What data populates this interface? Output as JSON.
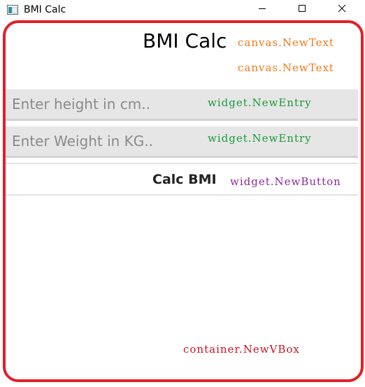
{
  "window": {
    "title": "BMI Calc"
  },
  "app": {
    "heading": "BMI Calc"
  },
  "annotations": {
    "canvas_text_1": "canvas.NewText",
    "canvas_text_2": "canvas.NewText",
    "entry_1": "widget.NewEntry",
    "entry_2": "widget.NewEntry",
    "button": "widget.NewButton",
    "vbox": "container.NewVBox"
  },
  "inputs": {
    "height_placeholder": "Enter height in cm..",
    "weight_placeholder": "Enter Weight in KG..",
    "height_value": "",
    "weight_value": ""
  },
  "buttons": {
    "calc_label": "Calc BMI"
  },
  "colors": {
    "frame_border": "#e0202a",
    "canvas_annotation": "#f07a1a",
    "entry_annotation": "#1a9a3a",
    "button_annotation": "#8a2a9a",
    "vbox_annotation": "#d01020"
  },
  "icons": {
    "app": "app-window-icon",
    "minimize": "minimize-icon",
    "maximize": "maximize-icon",
    "close": "close-icon"
  }
}
